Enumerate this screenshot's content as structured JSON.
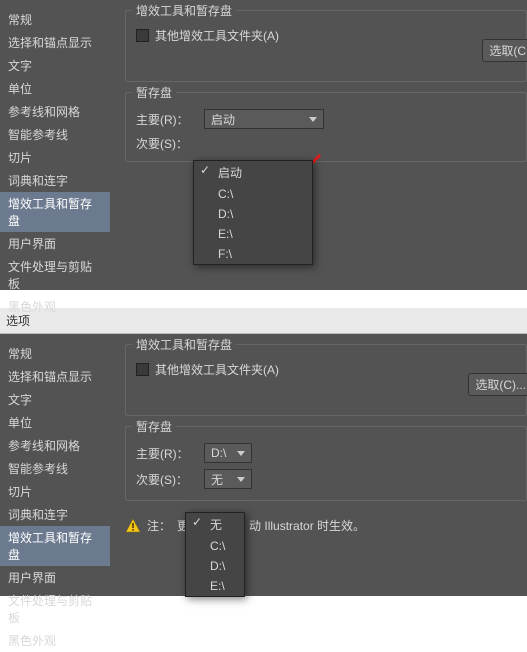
{
  "sidebar": {
    "items": [
      {
        "label": "常规"
      },
      {
        "label": "选择和锚点显示"
      },
      {
        "label": "文字"
      },
      {
        "label": "单位"
      },
      {
        "label": "参考线和网格"
      },
      {
        "label": "智能参考线"
      },
      {
        "label": "切片"
      },
      {
        "label": "词典和连字"
      },
      {
        "label": "增效工具和暂存盘"
      },
      {
        "label": "用户界面"
      },
      {
        "label": "文件处理与剪贴板"
      },
      {
        "label": "黑色外观"
      }
    ]
  },
  "group_plugins_title": "增效工具和暂存盘",
  "group_scratch_title": "暂存盘",
  "checkbox_other_plugins": "其他增效工具文件夹(A)",
  "btn_select1": "选取(C",
  "btn_select2": "选取(C)...",
  "label_primary": "主要(R)：",
  "label_secondary": "次要(S)：",
  "panel1": {
    "primary_value": "启动",
    "menu": [
      "启动",
      "C:\\",
      "D:\\",
      "E:\\",
      "F:\\"
    ],
    "menu_checked": 0
  },
  "panel2": {
    "primary_value": "D:\\",
    "secondary_value": "无",
    "menu": [
      "无",
      "C:\\",
      "D:\\",
      "E:\\"
    ],
    "menu_checked": 0,
    "note_prefix": "注：",
    "note_text": "更                  动 Illustrator 时生效。"
  },
  "titlebar": "选项"
}
